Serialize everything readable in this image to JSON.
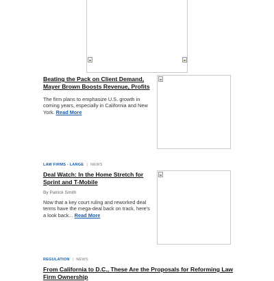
{
  "articles": [
    {
      "title": "Beating the Pack on Client Demand, Mayer Brown Boosts Revenue, Profits",
      "summary": "The firm plans to emphasize U.S. growth in coming years, especially in California and New York.",
      "read_more": "Read More"
    },
    {
      "category": "LAW FIRMS - LARGE",
      "separator": "|",
      "type": "NEWS",
      "title": "Deal Watch: In the Home Stretch for Sprint and T-Mobile",
      "byline": "By Patrick Smith",
      "summary": "Now that a key court ruling and reworked deal terms have the mega-deal back on track, here's a look back...",
      "read_more": "Read More"
    },
    {
      "category": "REGULATION",
      "separator": "|",
      "type": "NEWS",
      "title": "From California to D.C., These Are the Proposals for Reforming Law Firm Ownership"
    }
  ]
}
